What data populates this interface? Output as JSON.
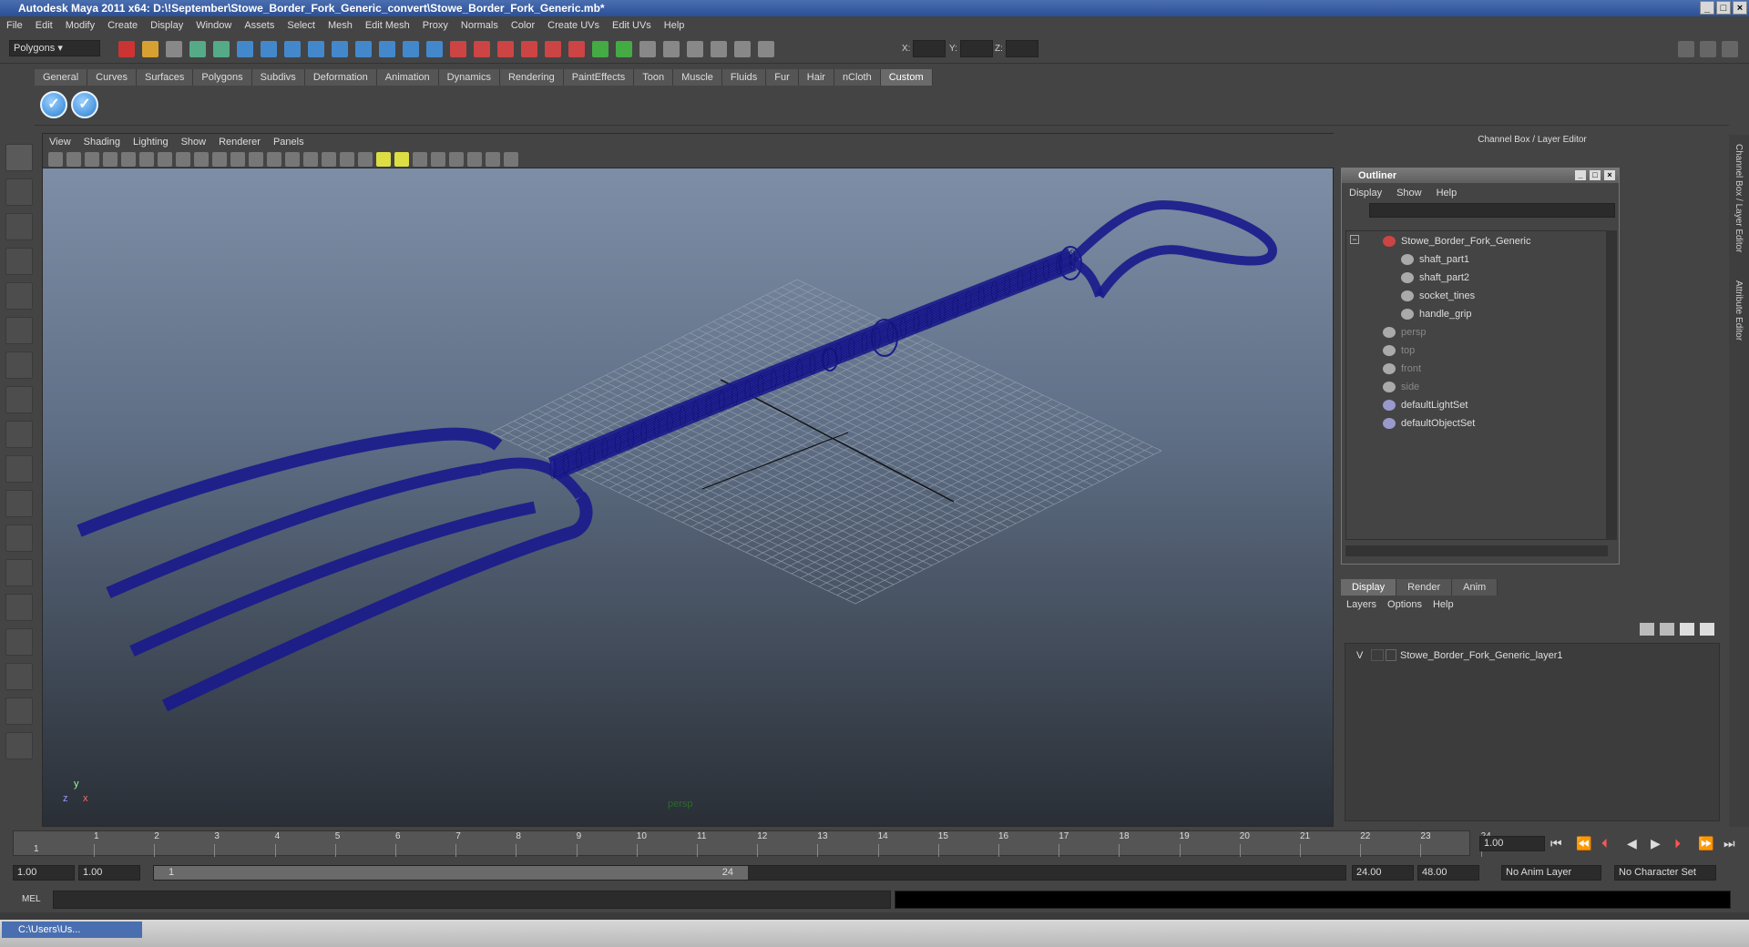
{
  "window": {
    "title": "Autodesk Maya 2011 x64: D:\\!September\\Stowe_Border_Fork_Generic_convert\\Stowe_Border_Fork_Generic.mb*"
  },
  "menubar": [
    "File",
    "Edit",
    "Modify",
    "Create",
    "Display",
    "Window",
    "Assets",
    "Select",
    "Mesh",
    "Edit Mesh",
    "Proxy",
    "Normals",
    "Color",
    "Create UVs",
    "Edit UVs",
    "Help"
  ],
  "statusline": {
    "mode": "Polygons",
    "x_label": "X:",
    "y_label": "Y:",
    "z_label": "Z:"
  },
  "shelf": {
    "tabs": [
      "General",
      "Curves",
      "Surfaces",
      "Polygons",
      "Subdivs",
      "Deformation",
      "Animation",
      "Dynamics",
      "Rendering",
      "PaintEffects",
      "Toon",
      "Muscle",
      "Fluids",
      "Fur",
      "Hair",
      "nCloth",
      "Custom"
    ],
    "active": "Custom"
  },
  "viewport": {
    "menu": [
      "View",
      "Shading",
      "Lighting",
      "Show",
      "Renderer",
      "Panels"
    ],
    "camera": "persp",
    "axis_y": "y",
    "axis_x": "x",
    "axis_z": "z",
    "wire_color": "#1a1a8c"
  },
  "channelbox": {
    "title": "Channel Box / Layer Editor",
    "side_tab_1": "Channel Box / Layer Editor",
    "side_tab_2": "Attribute Editor"
  },
  "outliner": {
    "title": "Outliner",
    "menu": [
      "Display",
      "Show",
      "Help"
    ],
    "items": [
      {
        "label": "Stowe_Border_Fork_Generic",
        "level": 0,
        "dim": false
      },
      {
        "label": "shaft_part1",
        "level": 1,
        "dim": false
      },
      {
        "label": "shaft_part2",
        "level": 1,
        "dim": false
      },
      {
        "label": "socket_tines",
        "level": 1,
        "dim": false
      },
      {
        "label": "handle_grip",
        "level": 1,
        "dim": false
      },
      {
        "label": "persp",
        "level": 0,
        "dim": true
      },
      {
        "label": "top",
        "level": 0,
        "dim": true
      },
      {
        "label": "front",
        "level": 0,
        "dim": true
      },
      {
        "label": "side",
        "level": 0,
        "dim": true
      },
      {
        "label": "defaultLightSet",
        "level": 0,
        "dim": false
      },
      {
        "label": "defaultObjectSet",
        "level": 0,
        "dim": false
      }
    ]
  },
  "layers": {
    "tabs": [
      "Display",
      "Render",
      "Anim"
    ],
    "active": "Display",
    "menu": [
      "Layers",
      "Options",
      "Help"
    ],
    "row": {
      "visible": "V",
      "name": "Stowe_Border_Fork_Generic_layer1"
    }
  },
  "timeline": {
    "ticks": [
      "1",
      "2",
      "3",
      "4",
      "5",
      "6",
      "7",
      "8",
      "9",
      "10",
      "11",
      "12",
      "13",
      "14",
      "15",
      "16",
      "17",
      "18",
      "19",
      "20",
      "21",
      "22",
      "23",
      "24"
    ],
    "current": "1",
    "current_time": "1.00"
  },
  "range": {
    "start": "1.00",
    "playback_start": "1.00",
    "slider_start": "1",
    "slider_end": "24",
    "playback_end": "24.00",
    "end": "48.00",
    "anim_layer": "No Anim Layer",
    "char_set": "No Character Set"
  },
  "cmd": {
    "label": "MEL"
  },
  "taskbar": {
    "item": "C:\\Users\\Us..."
  }
}
